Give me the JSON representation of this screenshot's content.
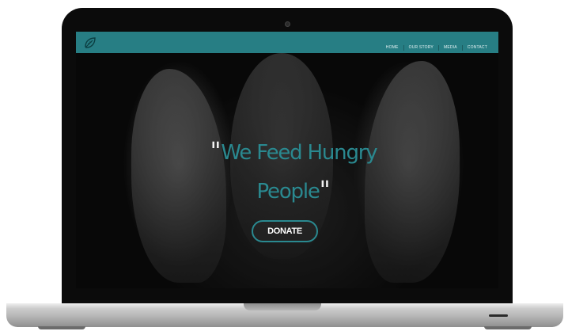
{
  "nav": {
    "items": [
      {
        "label": "HOME"
      },
      {
        "label": "OUR STORY"
      },
      {
        "label": "MEDIA"
      },
      {
        "label": "CONTACT"
      }
    ]
  },
  "hero": {
    "open_quote": "\"",
    "headline": "We Feed Hungry People",
    "close_quote": "\"",
    "donate_label": "DONATE"
  },
  "colors": {
    "accent": "#277e84",
    "headline": "#2a8990",
    "frame": "#0b0b0b"
  },
  "icons": {
    "logo": "leaf-logo-icon"
  }
}
